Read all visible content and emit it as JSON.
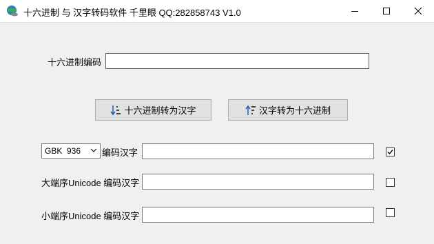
{
  "window": {
    "title": "十六进制 与 汉字转码软件 千里眼 QQ:282858743 V1.0"
  },
  "hex_field": {
    "label": "十六进制编码",
    "value": ""
  },
  "buttons": {
    "hex_to_chinese": "十六进制转为汉字",
    "chinese_to_hex": "汉字转为十六进制"
  },
  "gbk_row": {
    "encoding_selected": "GBK  936",
    "label": "编码汉字",
    "value": "",
    "checked": true
  },
  "big_endian_row": {
    "label": "大端序Unicode 编码汉字",
    "value": "",
    "checked": false
  },
  "little_endian_row": {
    "label": "小端序Unicode 编码汉字",
    "value": "",
    "checked": false
  }
}
